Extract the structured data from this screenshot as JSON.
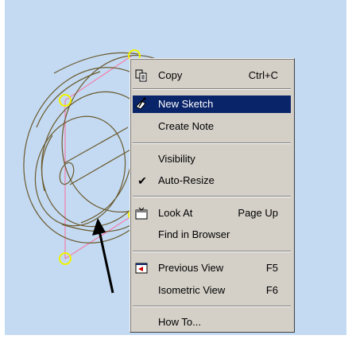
{
  "menu": {
    "items": [
      {
        "label": "Copy",
        "shortcut": "Ctrl+C",
        "icon": "copy-icon"
      },
      {
        "label": "New Sketch",
        "shortcut": "",
        "icon": "sketch-icon"
      },
      {
        "label": "Create Note",
        "shortcut": "",
        "icon": ""
      },
      {
        "label": "Visibility",
        "shortcut": "",
        "icon": ""
      },
      {
        "label": "Auto-Resize",
        "shortcut": "",
        "icon": "checkmark",
        "checked": true
      },
      {
        "label": "Look At",
        "shortcut": "Page Up",
        "icon": "look-at-icon"
      },
      {
        "label": "Find in Browser",
        "shortcut": "",
        "icon": ""
      },
      {
        "label": "Previous View",
        "shortcut": "F5",
        "icon": "previous-view-icon"
      },
      {
        "label": "Isometric View",
        "shortcut": "F6",
        "icon": ""
      },
      {
        "label": "How To...",
        "shortcut": "",
        "icon": ""
      }
    ]
  },
  "colors": {
    "viewport_bg": "#c3daf2",
    "menu_bg": "#d4d0c8",
    "highlight": "#0a246a",
    "model_edges": "#6b5a2e",
    "construction_lines": "#ff6b9a",
    "grips": "#f2f200"
  }
}
